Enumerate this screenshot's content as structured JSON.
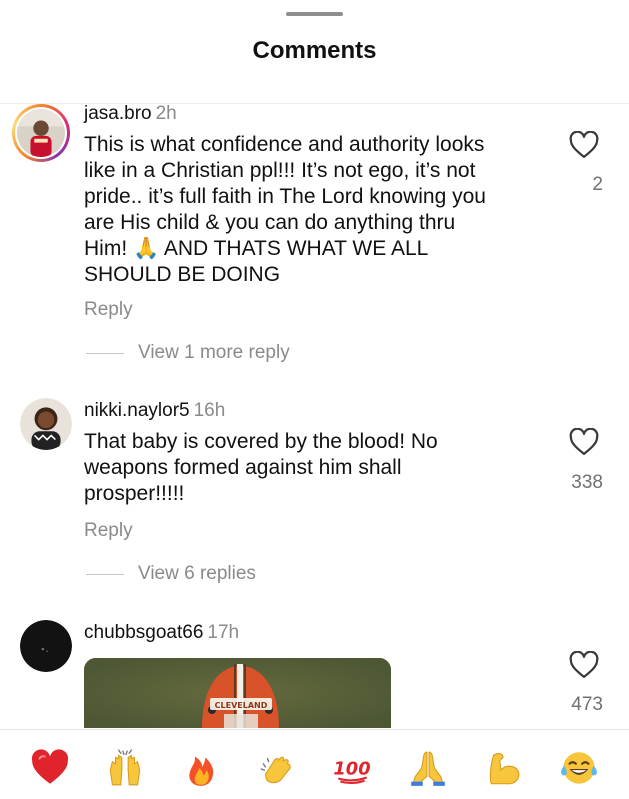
{
  "sheet": {
    "title": "Comments"
  },
  "comments": [
    {
      "username": "jasa.bro",
      "time": "2h",
      "lines": [
        "This is what confidence and authority looks",
        "like in a Christian ppl!!! It’s not ego, it’s not",
        "pride.. it’s full faith in The Lord knowing you",
        "are His child & you can do anything thru",
        "Him! 🙏 AND THATS WHAT WE ALL",
        "SHOULD BE DOING"
      ],
      "likes": "2",
      "reply_label": "Reply",
      "view_replies": "View 1 more reply"
    },
    {
      "username": "nikki.naylor5",
      "time": "16h",
      "lines": [
        "That baby is covered by the blood!  No",
        "weapons formed against him shall",
        "prosper!!!!!"
      ],
      "likes": "338",
      "reply_label": "Reply",
      "view_replies": "View 6 replies"
    },
    {
      "username": "chubbsgoat66",
      "time": "17h",
      "likes": "473",
      "media_caption": "CLEVELAND"
    }
  ],
  "reactions": [
    "heart",
    "raised-hands",
    "fire",
    "clapping-hands",
    "hundred-points",
    "folded-hands",
    "flexed-biceps",
    "tears-of-joy"
  ],
  "colors": {
    "accent_text": "#111111",
    "muted": "#8a8a8a"
  }
}
